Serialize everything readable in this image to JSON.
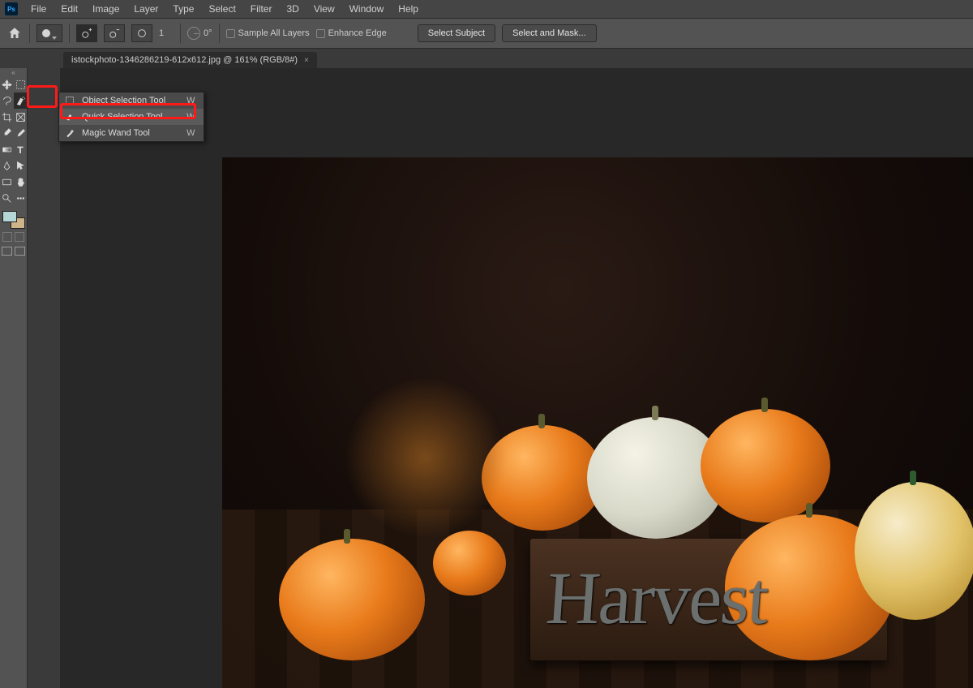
{
  "menu": {
    "items": [
      "File",
      "Edit",
      "Image",
      "Layer",
      "Type",
      "Select",
      "Filter",
      "3D",
      "View",
      "Window",
      "Help"
    ],
    "logo": "Ps"
  },
  "options": {
    "brush_size": "1",
    "angle": "0°",
    "sample_all": "Sample All Layers",
    "enhance": "Enhance Edge",
    "select_subject": "Select Subject",
    "select_mask": "Select and Mask..."
  },
  "tab": {
    "title": "istockphoto-1346286219-612x612.jpg @ 161% (RGB/8#)"
  },
  "flyout": {
    "items": [
      {
        "label": "Object Selection Tool",
        "shortcut": "W"
      },
      {
        "label": "Quick Selection Tool",
        "shortcut": "W"
      },
      {
        "label": "Magic Wand Tool",
        "shortcut": "W"
      }
    ]
  },
  "canvas": {
    "sign": "Harvest"
  },
  "colors": {
    "fg": "#b5d6d6",
    "bg": "#cfb48a"
  }
}
